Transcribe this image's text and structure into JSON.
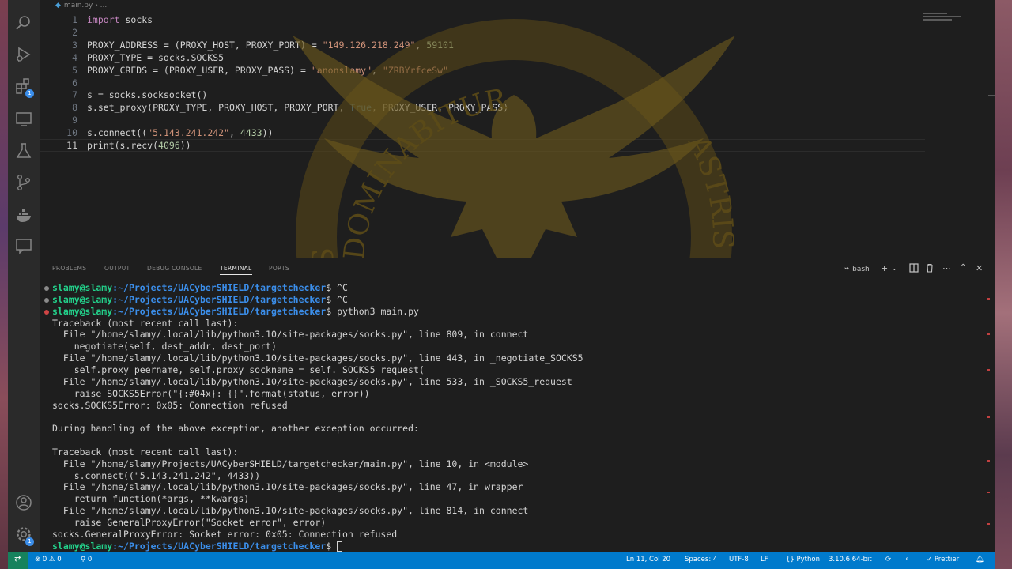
{
  "breadcrumb": {
    "file": "main.py",
    "sep": "› ..."
  },
  "activity_badges": {
    "extensions": "1",
    "accounts": "1"
  },
  "code_lines": [
    {
      "n": "1",
      "html": "<span class=\"kw\">import</span> socks"
    },
    {
      "n": "2",
      "html": ""
    },
    {
      "n": "3",
      "html": "PROXY_ADDRESS = (PROXY_HOST, PROXY_PORT) = <span class=\"str\">\"149.126.218.249\"</span>, <span class=\"num\">59101</span>"
    },
    {
      "n": "4",
      "html": "PROXY_TYPE = socks.SOCKS5"
    },
    {
      "n": "5",
      "html": "PROXY_CREDS = (PROXY_USER, PROXY_PASS) = <span class=\"str\">\"anonslamy\"</span>, <span class=\"str\">\"ZRBYrfceSw\"</span>"
    },
    {
      "n": "6",
      "html": ""
    },
    {
      "n": "7",
      "html": "s = socks.socksocket()"
    },
    {
      "n": "8",
      "html": "s.set_proxy(PROXY_TYPE, PROXY_HOST, PROXY_PORT, <span class=\"const\">True</span>, PROXY_USER, PROXY_PASS)"
    },
    {
      "n": "9",
      "html": ""
    },
    {
      "n": "10",
      "html": "s.connect((<span class=\"str\">\"5.143.241.242\"</span>, <span class=\"num\">4433</span>))"
    },
    {
      "n": "11",
      "html": "print(s.recv(<span class=\"num\">4096</span>))"
    }
  ],
  "panel_tabs": [
    "PROBLEMS",
    "OUTPUT",
    "DEBUG CONSOLE",
    "TERMINAL",
    "PORTS"
  ],
  "panel_active_tab": "TERMINAL",
  "terminal_shell": "bash",
  "prompt": {
    "user": "slamy@slamy",
    "path": ":~/Projects/UACyberSHIELD/targetchecker",
    "symbol": "$ "
  },
  "terminal_commands": [
    "^C",
    "^C",
    "python3 main.py",
    ""
  ],
  "terminal_output": [
    "Traceback (most recent call last):",
    "  File \"/home/slamy/.local/lib/python3.10/site-packages/socks.py\", line 809, in connect",
    "    negotiate(self, dest_addr, dest_port)",
    "  File \"/home/slamy/.local/lib/python3.10/site-packages/socks.py\", line 443, in _negotiate_SOCKS5",
    "    self.proxy_peername, self.proxy_sockname = self._SOCKS5_request(",
    "  File \"/home/slamy/.local/lib/python3.10/site-packages/socks.py\", line 533, in _SOCKS5_request",
    "    raise SOCKS5Error(\"{:#04x}: {}\".format(status, error))",
    "socks.SOCKS5Error: 0x05: Connection refused",
    "",
    "During handling of the above exception, another exception occurred:",
    "",
    "Traceback (most recent call last):",
    "  File \"/home/slamy/Projects/UACyberSHIELD/targetchecker/main.py\", line 10, in <module>",
    "    s.connect((\"5.143.241.242\", 4433))",
    "  File \"/home/slamy/.local/lib/python3.10/site-packages/socks.py\", line 47, in wrapper",
    "    return function(*args, **kwargs)",
    "  File \"/home/slamy/.local/lib/python3.10/site-packages/socks.py\", line 814, in connect",
    "    raise GeneralProxyError(\"Socket error\", error)",
    "socks.GeneralProxyError: Socket error: 0x05: Connection refused"
  ],
  "emblem": {
    "top_text": "DOMINABITUR",
    "left_text": "SAPIENS",
    "right_text": "ASTRIS",
    "color": "#7a6420"
  },
  "status_bar": {
    "errors": "⊗ 0 ⚠ 0",
    "ports": "⚲ 0",
    "position": "Ln 11, Col 20",
    "spaces": "Spaces: 4",
    "encoding": "UTF-8",
    "eol": "LF",
    "language": "{} Python",
    "interpreter": "3.10.6 64-bit",
    "formatter": "✓ Prettier"
  },
  "colors": {
    "status_bar": "#007acc",
    "prompt_user": "#23d18b",
    "prompt_path": "#3b8eea"
  }
}
